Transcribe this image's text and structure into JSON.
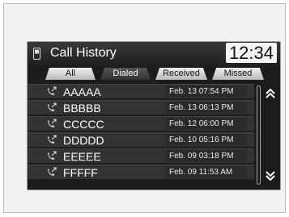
{
  "header": {
    "title": "Call History",
    "time": "12:34"
  },
  "tabs": [
    {
      "label": "All"
    },
    {
      "label": "Dialed",
      "active": true
    },
    {
      "label": "Received"
    },
    {
      "label": "Missed"
    }
  ],
  "calls": [
    {
      "name": "AAAAA",
      "date": "Feb. 13 07:54 PM"
    },
    {
      "name": "BBBBB",
      "date": "Feb. 13 06:13 PM"
    },
    {
      "name": "CCCCC",
      "date": "Feb. 12 06:00 PM"
    },
    {
      "name": "DDDDD",
      "date": "Feb. 10 05:16 PM"
    },
    {
      "name": "EEEEE",
      "date": "Feb. 09 03:18 PM"
    },
    {
      "name": "FFFFF",
      "date": "Feb. 09 11:53 AM"
    }
  ],
  "icons": {
    "phone": "phone-icon",
    "dialed_call": "outgoing-call-icon",
    "scroll_up": "double-chevron-up-icon",
    "scroll_down": "double-chevron-down-icon"
  }
}
